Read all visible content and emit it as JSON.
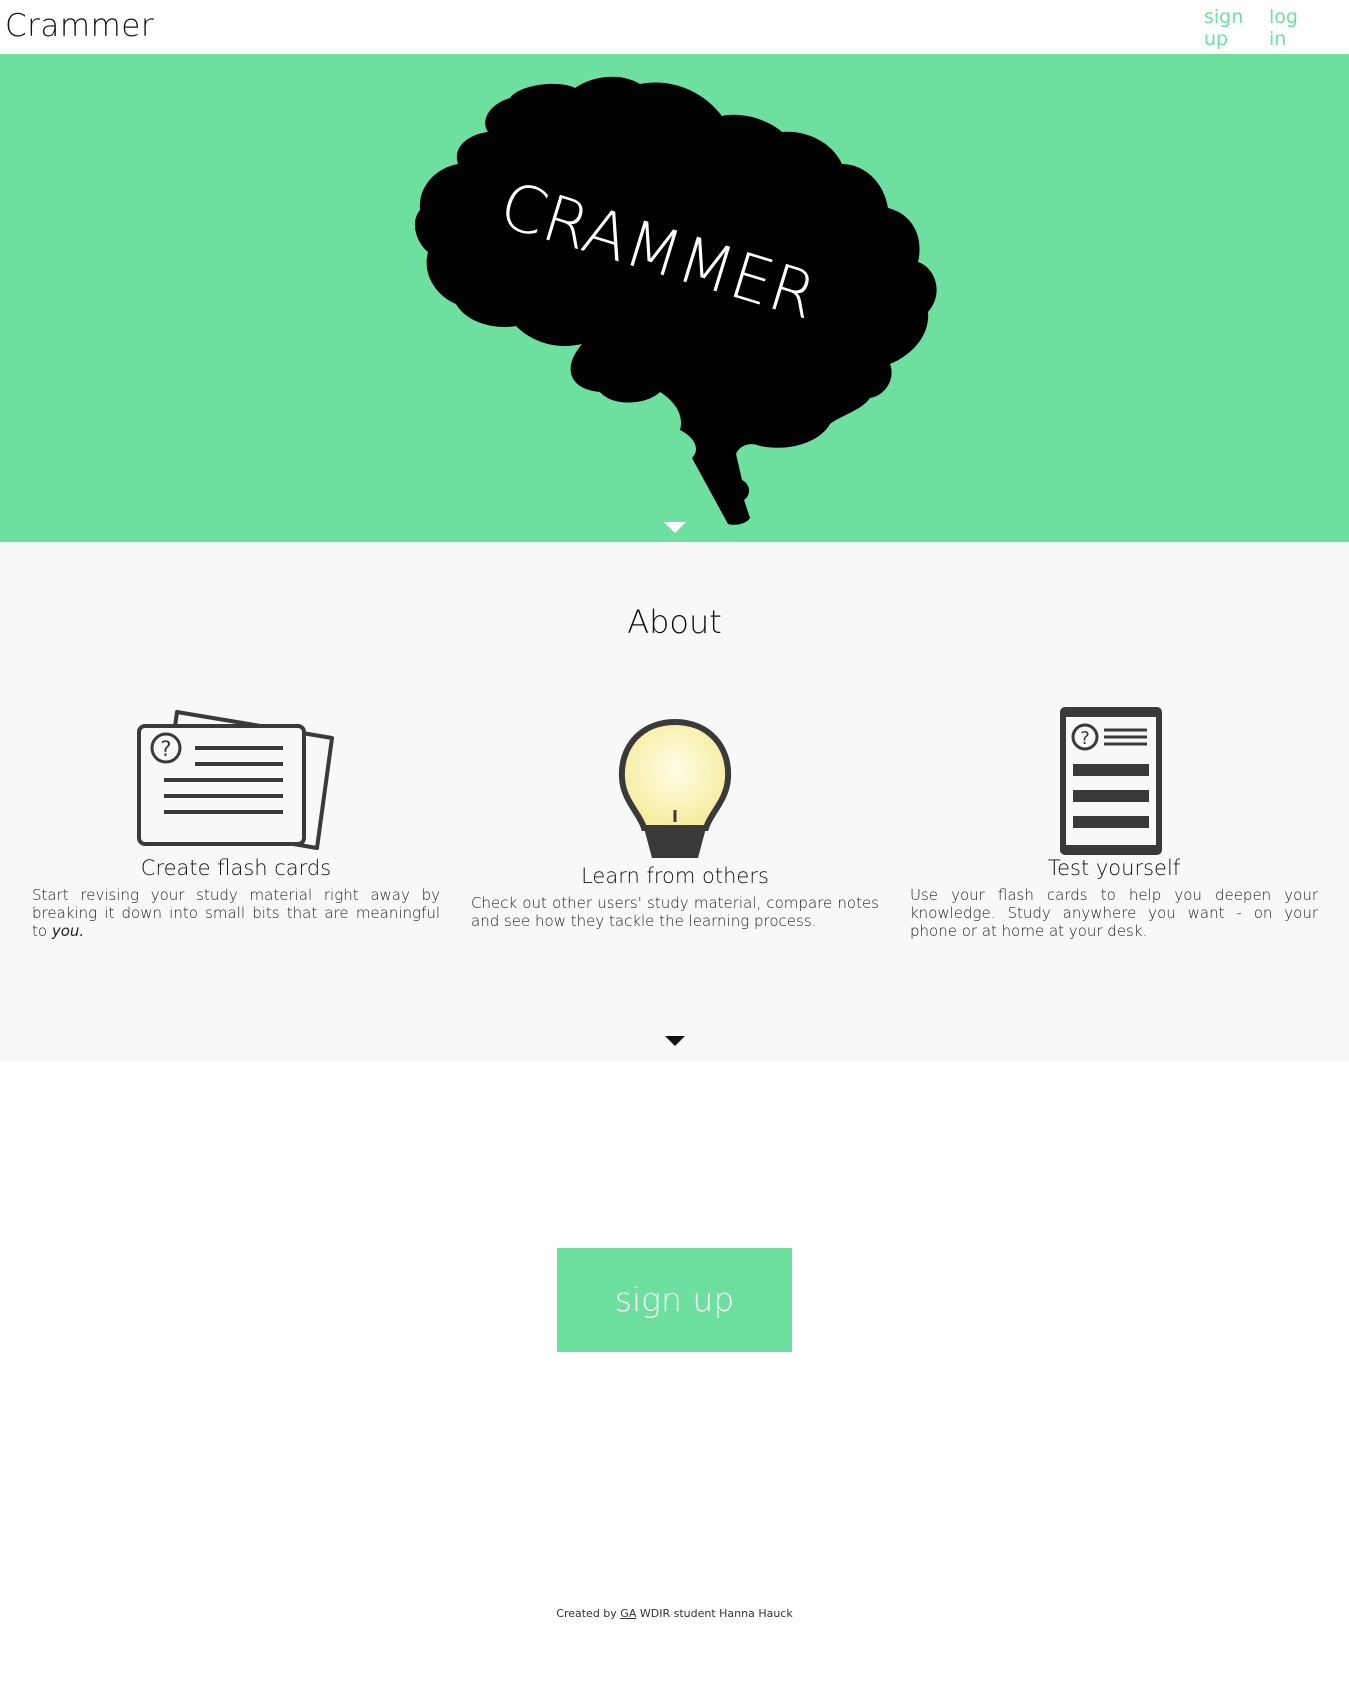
{
  "header": {
    "brand": "Crammer",
    "nav": {
      "signup": "sign up",
      "login": "log in"
    }
  },
  "hero": {
    "logo_text": "CRAMMER",
    "colors": {
      "background": "#6ddf9f",
      "brain": "#000000",
      "logo_text": "#ffffff"
    },
    "arrow_icon": "chevron-down-icon"
  },
  "about": {
    "title": "About",
    "features": [
      {
        "icon": "flash-cards-icon",
        "title": "Create flash cards",
        "desc_main": "Start revising your study material right away by breaking it down into small bits that are meaningful to ",
        "desc_em": "you."
      },
      {
        "icon": "light-bulb-icon",
        "title": "Learn from others",
        "desc_main": "Check out other users' study material, compare notes and see how they tackle the learning process.",
        "desc_em": ""
      },
      {
        "icon": "test-sheet-icon",
        "title": "Test yourself",
        "desc_main": "Use your flash cards to help you deepen your knowledge. Study anywhere you want - on your phone or at home at your desk.",
        "desc_em": ""
      }
    ]
  },
  "cta": {
    "label": "sign up"
  },
  "footer": {
    "prefix": "Created by ",
    "link": "GA",
    "suffix": " WDIR student Hanna Hauck"
  },
  "colors": {
    "accent": "#6ddf9f",
    "about_bg": "#f8f8f8",
    "icon": "#3a3a3a"
  }
}
